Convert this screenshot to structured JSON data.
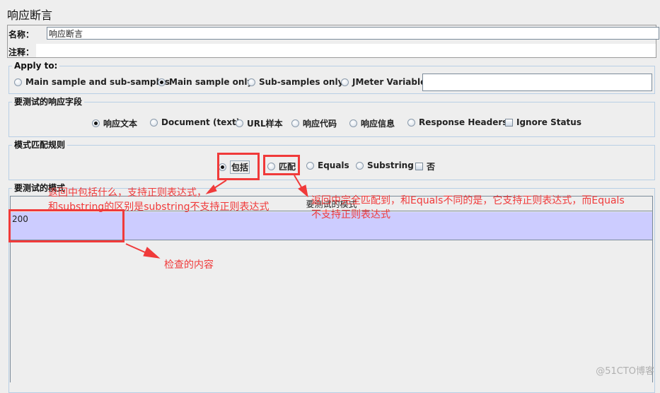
{
  "header": {
    "title": "响应断言"
  },
  "name_section": {
    "name_label": "名称：",
    "name_value": "响应断言",
    "comment_label": "注释：",
    "comment_value": ""
  },
  "apply_to": {
    "legend": "Apply to:",
    "options": [
      {
        "label": "Main sample and sub-samples",
        "selected": false
      },
      {
        "label": "Main sample only",
        "selected": true
      },
      {
        "label": "Sub-samples only",
        "selected": false
      },
      {
        "label": "JMeter Variable",
        "selected": false
      }
    ],
    "variable_value": ""
  },
  "response_field": {
    "legend": "要测试的响应字段",
    "options": [
      {
        "label": "响应文本",
        "selected": true
      },
      {
        "label": "Document (text)",
        "selected": false
      },
      {
        "label": "URL样本",
        "selected": false
      },
      {
        "label": "响应代码",
        "selected": false
      },
      {
        "label": "响应信息",
        "selected": false
      },
      {
        "label": "Response Headers",
        "selected": false
      }
    ],
    "ignore_status": {
      "label": "Ignore Status",
      "checked": false
    }
  },
  "pattern_rules": {
    "legend": "模式匹配规则",
    "options": [
      {
        "label": "包括",
        "selected": true
      },
      {
        "label": "匹配",
        "selected": false
      },
      {
        "label": "Equals",
        "selected": false
      },
      {
        "label": "Substring",
        "selected": false
      }
    ],
    "not": {
      "label": "否",
      "checked": false
    }
  },
  "patterns": {
    "legend": "要测试的模式",
    "column_header": "要测试的模式",
    "rows": [
      "200"
    ]
  },
  "annotations": {
    "contains_line1": "返回中包括什么，支持正则表达式，",
    "contains_line2": "和substring的区别是substring不支持正则表达式",
    "matches_line1": "返回中完全匹配到，和Equals不同的是，它支持正则表达式，而Equals",
    "matches_line2": "不支持正则表达式",
    "content_note": "检查的内容",
    "color": "#f03a3a"
  },
  "watermark": "@51CTO博客"
}
